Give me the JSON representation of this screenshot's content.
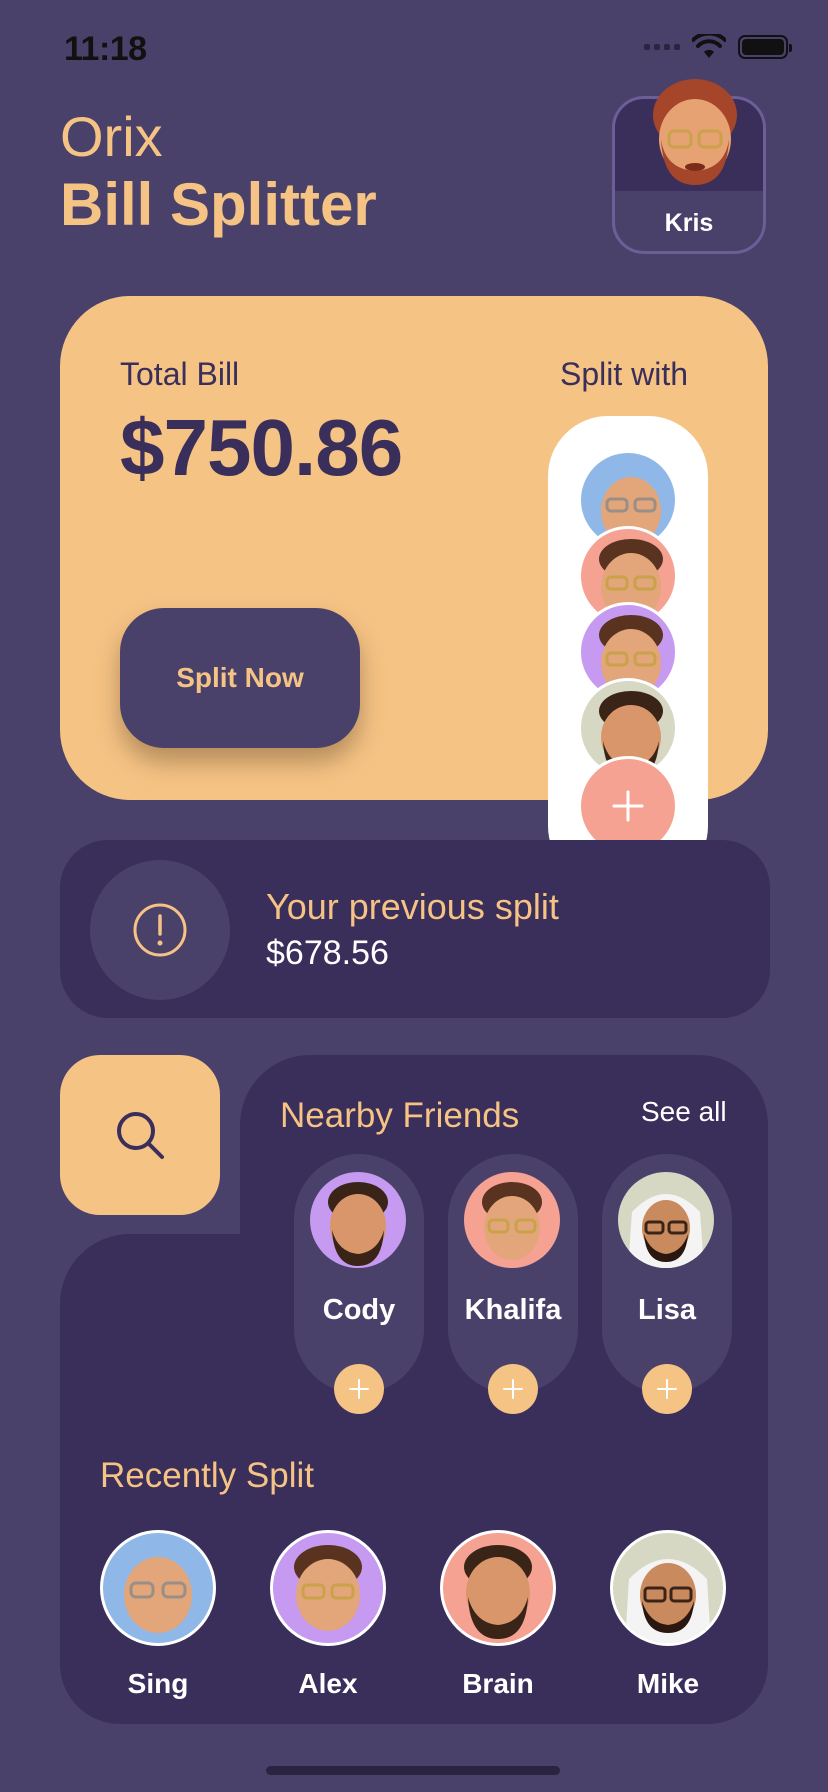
{
  "status_bar": {
    "time": "11:18"
  },
  "header": {
    "brand": "Orix",
    "title": "Bill Splitter"
  },
  "profile": {
    "name": "Kris"
  },
  "bill": {
    "total_label": "Total Bill",
    "total_value": "$750.86",
    "split_with_label": "Split with",
    "split_button": "Split Now"
  },
  "previous": {
    "label": "Your previous split",
    "value": "$678.56"
  },
  "nearby": {
    "title": "Nearby Friends",
    "see_all": "See all",
    "friends": [
      {
        "name": "Cody",
        "bg": "#c59af0"
      },
      {
        "name": "Khalifa",
        "bg": "#f5a293"
      },
      {
        "name": "Lisa",
        "bg": "#d6d8c4"
      }
    ]
  },
  "recent": {
    "title": "Recently Split",
    "people": [
      {
        "name": "Sing",
        "bg": "#8fb8e8"
      },
      {
        "name": "Alex",
        "bg": "#c59af0"
      },
      {
        "name": "Brain",
        "bg": "#f5a293"
      },
      {
        "name": "Mike",
        "bg": "#d6d8c4"
      }
    ]
  },
  "colors": {
    "background": "#4a416b",
    "panel": "#3a2e5a",
    "accent": "#f5c384",
    "coral": "#f5a293"
  }
}
